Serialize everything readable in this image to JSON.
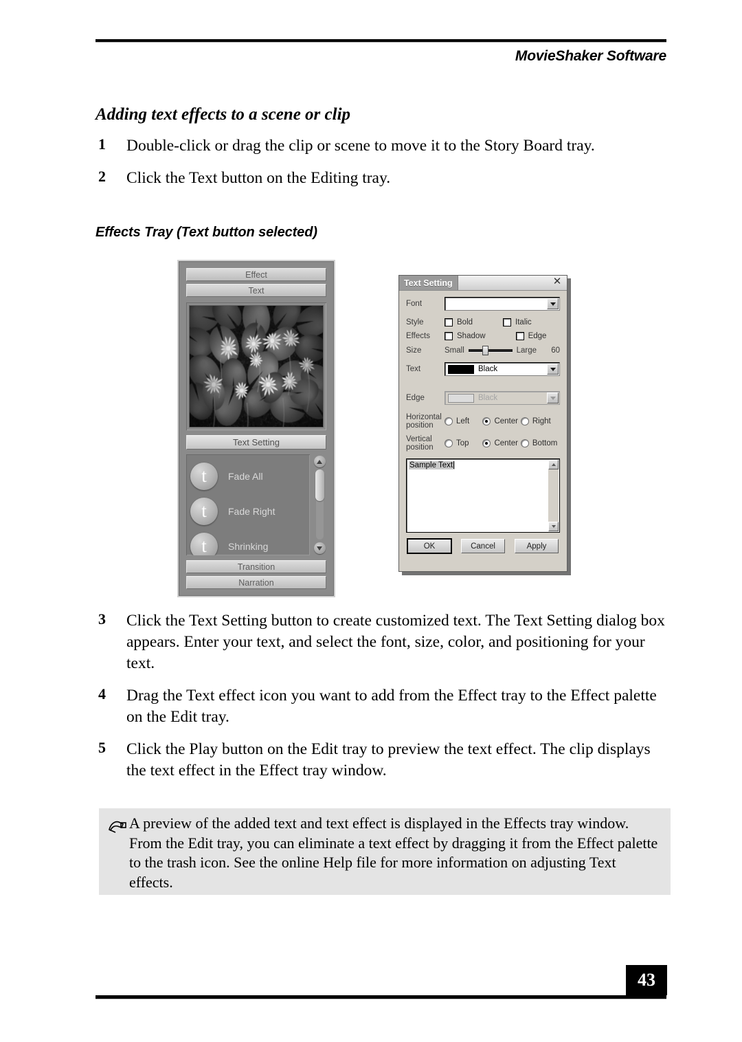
{
  "header": {
    "title": "MovieShaker Software"
  },
  "section_title": "Adding text effects to a scene or clip",
  "figure_caption": "Effects Tray (Text button selected)",
  "steps_top": [
    {
      "num": "1",
      "text": "Double-click or drag the clip or scene to move it to the Story Board tray."
    },
    {
      "num": "2",
      "text": "Click the Text button on the Editing tray."
    }
  ],
  "steps_bottom": [
    {
      "num": "3",
      "text": "Click the Text Setting button to create customized text. The Text Setting dialog box appears. Enter your text, and select the font, size, color, and positioning for your text."
    },
    {
      "num": "4",
      "text": "Drag the Text effect icon you want to add from the Effect tray to the Effect palette on the Edit tray."
    },
    {
      "num": "5",
      "text": "Click the Play button on the Edit tray to preview the text effect. The clip displays the text effect in the Effect tray window."
    }
  ],
  "note": {
    "icon": "note-pencil-icon",
    "text": "A preview of the added text and text effect is displayed in the Effects tray window. From the Edit tray, you can eliminate a text effect by dragging it from the Effect palette to the trash icon. See the online Help file for more information on adjusting Text effects."
  },
  "footer": {
    "page_number": "43"
  },
  "effects_tray": {
    "top_buttons": [
      {
        "label": "Effect"
      },
      {
        "label": "Text"
      }
    ],
    "preview_alt": "water lilies preview image",
    "text_setting_button": "Text Setting",
    "effects": [
      {
        "icon_glyph": "t",
        "label": "Fade All"
      },
      {
        "icon_glyph": "t",
        "label": "Fade Right"
      },
      {
        "icon_glyph": "t",
        "label": "Shrinking"
      }
    ],
    "bottom_buttons": [
      {
        "label": "Transition"
      },
      {
        "label": "Narration"
      }
    ],
    "scrollbar": {
      "up": "▲",
      "down": "▼"
    }
  },
  "dialog": {
    "title": "Text Setting",
    "close": "✕",
    "font": {
      "label": "Font",
      "value": ""
    },
    "style": {
      "label": "Style",
      "options": [
        {
          "label": "Bold",
          "checked": false
        },
        {
          "label": "Italic",
          "checked": false
        }
      ]
    },
    "effects": {
      "label": "Effects",
      "options": [
        {
          "label": "Shadow",
          "checked": false
        },
        {
          "label": "Edge",
          "checked": false
        }
      ]
    },
    "size": {
      "label": "Size",
      "min_label": "Small",
      "max_label": "Large",
      "value": "60"
    },
    "text_color": {
      "label": "Text",
      "value": "Black",
      "swatch": "#000000"
    },
    "edge_color": {
      "label": "Edge",
      "value": "Black",
      "swatch": "#dcdcdc",
      "disabled": true
    },
    "horizontal_position": {
      "label_line1": "Horizontal",
      "label_line2": "position",
      "options": [
        {
          "label": "Left",
          "selected": false
        },
        {
          "label": "Center",
          "selected": true
        },
        {
          "label": "Right",
          "selected": false
        }
      ]
    },
    "vertical_position": {
      "label_line1": "Vertical",
      "label_line2": "position",
      "options": [
        {
          "label": "Top",
          "selected": false
        },
        {
          "label": "Center",
          "selected": true
        },
        {
          "label": "Bottom",
          "selected": false
        }
      ]
    },
    "text_input": {
      "value": "Sample Text"
    },
    "buttons": [
      {
        "label": "OK",
        "default": true
      },
      {
        "label": "Cancel",
        "default": false
      },
      {
        "label": "Apply",
        "default": false
      }
    ]
  }
}
